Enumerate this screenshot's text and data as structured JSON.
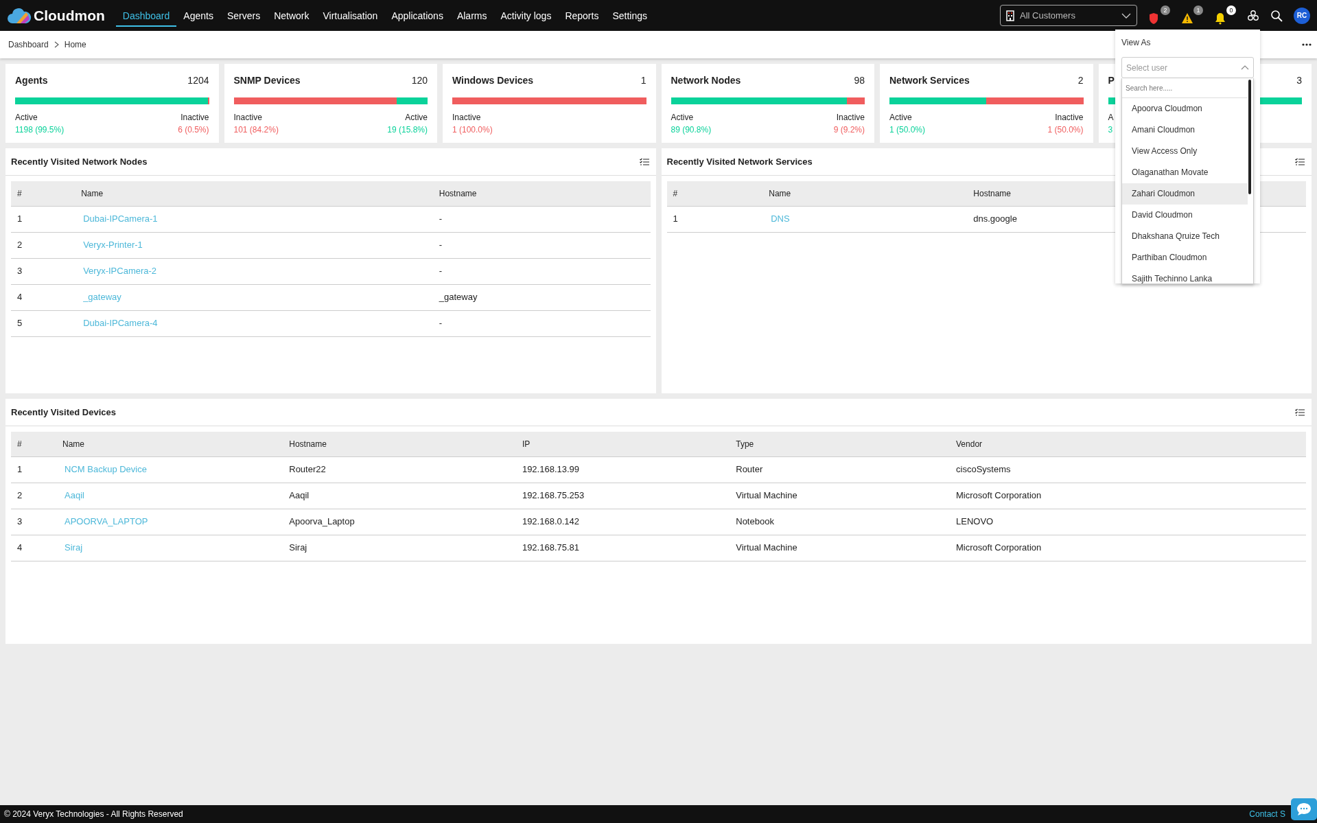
{
  "navbar": {
    "brand": "Cloudmon",
    "items": [
      {
        "label": "Dashboard",
        "selected": true
      },
      {
        "label": "Agents",
        "selected": false
      },
      {
        "label": "Servers",
        "selected": false
      },
      {
        "label": "Network",
        "selected": false
      },
      {
        "label": "Virtualisation",
        "selected": false
      },
      {
        "label": "Applications",
        "selected": false
      },
      {
        "label": "Alarms",
        "selected": false
      },
      {
        "label": "Activity logs",
        "selected": false
      },
      {
        "label": "Reports",
        "selected": false
      },
      {
        "label": "Settings",
        "selected": false
      }
    ],
    "customer_select": {
      "value": "All Customers"
    },
    "alerts": [
      {
        "kind": "shield",
        "count": "2"
      },
      {
        "kind": "warning",
        "count": "1"
      },
      {
        "kind": "bell",
        "count": "0"
      }
    ],
    "avatar": "RC"
  },
  "breadcrumb": [
    "Dashboard",
    "Home"
  ],
  "stat_cards": [
    {
      "title": "Agents",
      "count": "1204",
      "bar": {
        "fill_active": true,
        "level": 0.995
      },
      "stats": [
        {
          "label": "Active",
          "value": "1198 (99.5%)",
          "kind": "active"
        },
        {
          "label": "Inactive",
          "value": "6 (0.5%)",
          "kind": "inactive"
        }
      ]
    },
    {
      "title": "SNMP Devices",
      "count": "120",
      "bar": {
        "fill_active": false,
        "level": 0.842
      },
      "stats": [
        {
          "label": "Inactive",
          "value": "101 (84.2%)",
          "kind": "inactive"
        },
        {
          "label": "Active",
          "value": "19 (15.8%)",
          "kind": "active"
        }
      ]
    },
    {
      "title": "Windows Devices",
      "count": "1",
      "bar": {
        "fill_active": false,
        "level": 1
      },
      "stats": [
        {
          "label": "Inactive",
          "value": "1 (100.0%)",
          "kind": "inactive"
        }
      ]
    },
    {
      "title": "Network Nodes",
      "count": "98",
      "bar": {
        "fill_active": true,
        "level": 0.908
      },
      "stats": [
        {
          "label": "Active",
          "value": "89 (90.8%)",
          "kind": "active"
        },
        {
          "label": "Inactive",
          "value": "9 (9.2%)",
          "kind": "inactive"
        }
      ]
    },
    {
      "title": "Network Services",
      "count": "2",
      "bar": {
        "fill_active": true,
        "level": 0.5
      },
      "stats": [
        {
          "label": "Active",
          "value": "1 (50.0%)",
          "kind": "active"
        },
        {
          "label": "Inactive",
          "value": "1 (50.0%)",
          "kind": "inactive"
        }
      ]
    },
    {
      "title": "P",
      "count": "3",
      "bar": {
        "fill_active": true,
        "level": 1
      },
      "stats": [
        {
          "label": "A",
          "value": "3",
          "kind": "active"
        }
      ]
    }
  ],
  "panels": [
    {
      "title": "Recently Visited Network Nodes",
      "columns": [
        {
          "label": "#",
          "kind": "text"
        },
        {
          "label": "Name",
          "kind": "link"
        },
        {
          "label": "Hostname",
          "kind": "text"
        }
      ],
      "rows": [
        [
          "1",
          "Dubai-IPCamera-1",
          "-"
        ],
        [
          "2",
          "Veryx-Printer-1",
          "-"
        ],
        [
          "3",
          "Veryx-IPCamera-2",
          "-"
        ],
        [
          "4",
          "_gateway",
          "_gateway"
        ],
        [
          "5",
          "Dubai-IPCamera-4",
          "-"
        ]
      ]
    },
    {
      "title": "Recently Visited Network Services",
      "columns": [
        {
          "label": "#",
          "kind": "text"
        },
        {
          "label": "Name",
          "kind": "link"
        },
        {
          "label": "Hostname",
          "kind": "text"
        }
      ],
      "rows": [
        [
          "1",
          "DNS",
          "dns.google"
        ]
      ]
    },
    {
      "title": "Recently Visited Devices",
      "columns": [
        {
          "label": "#",
          "kind": "text"
        },
        {
          "label": "Name",
          "kind": "link"
        },
        {
          "label": "Hostname",
          "kind": "text"
        },
        {
          "label": "IP",
          "kind": "text"
        },
        {
          "label": "Type",
          "kind": "text"
        },
        {
          "label": "Vendor",
          "kind": "text"
        }
      ],
      "rows": [
        [
          "1",
          "NCM Backup Device",
          "Router22",
          "192.168.13.99",
          "Router",
          "ciscoSystems"
        ],
        [
          "2",
          "Aaqil",
          "Aaqil",
          "192.168.75.253",
          "Virtual Machine",
          "Microsoft Corporation"
        ],
        [
          "3",
          "APOORVA_LAPTOP",
          "Apoorva_Laptop",
          "192.168.0.142",
          "Notebook",
          "LENOVO"
        ],
        [
          "4",
          "Siraj",
          "Siraj",
          "192.168.75.81",
          "Virtual Machine",
          "Microsoft Corporation"
        ]
      ]
    }
  ],
  "view_as": {
    "label": "View As",
    "select": {
      "placeholder": "Select user"
    },
    "search": {
      "placeholder": "Search here....."
    },
    "users": [
      {
        "name": "Apoorva Cloudmon",
        "selected": false
      },
      {
        "name": "Amani Cloudmon",
        "selected": false
      },
      {
        "name": "View Access Only",
        "selected": false
      },
      {
        "name": "Olaganathan Movate",
        "selected": false
      },
      {
        "name": "Zahari Cloudmon",
        "selected": true
      },
      {
        "name": "David Cloudmon",
        "selected": false
      },
      {
        "name": "Dhakshana Qruize Tech",
        "selected": false
      },
      {
        "name": "Parthiban Cloudmon",
        "selected": false
      },
      {
        "name": "Sajith Techinno Lanka",
        "selected": false
      }
    ]
  },
  "footer": {
    "copyright": "© 2024 Veryx Technologies - All Rights Reserved",
    "link": "Contact S"
  }
}
